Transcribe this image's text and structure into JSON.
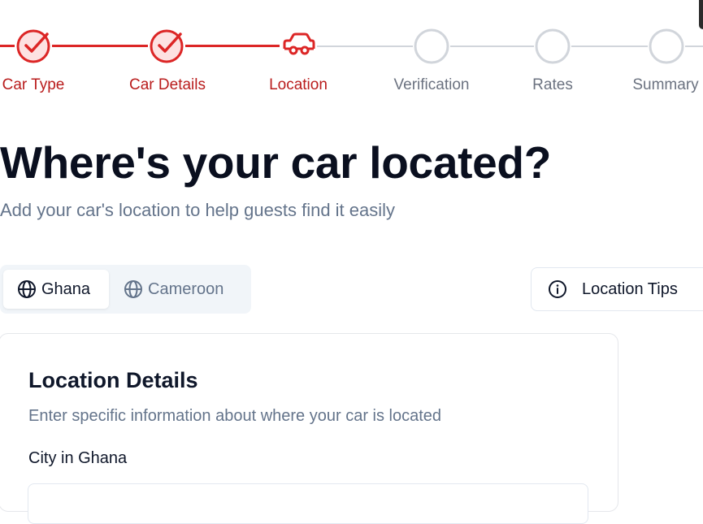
{
  "stepper": {
    "steps": [
      {
        "label": "Car Type",
        "state": "done"
      },
      {
        "label": "Car Details",
        "state": "done"
      },
      {
        "label": "Location",
        "state": "current"
      },
      {
        "label": "Verification",
        "state": "pending"
      },
      {
        "label": "Rates",
        "state": "pending"
      },
      {
        "label": "Summary",
        "state": "pending"
      }
    ],
    "colors": {
      "active": "#dc2626",
      "pending": "#d1d5db"
    }
  },
  "header": {
    "title": "Where's your car located?",
    "subtitle": "Add your car's location to help guests find it easily"
  },
  "country_tabs": {
    "selected": "Ghana",
    "items": [
      {
        "label": "Ghana",
        "icon": "globe-icon"
      },
      {
        "label": "Cameroon",
        "icon": "globe-icon"
      }
    ]
  },
  "tips_button": {
    "label": "Location Tips",
    "icon": "info-icon"
  },
  "location_card": {
    "title": "Location Details",
    "description": "Enter specific information about where your car is located",
    "city_label": "City in Ghana"
  }
}
